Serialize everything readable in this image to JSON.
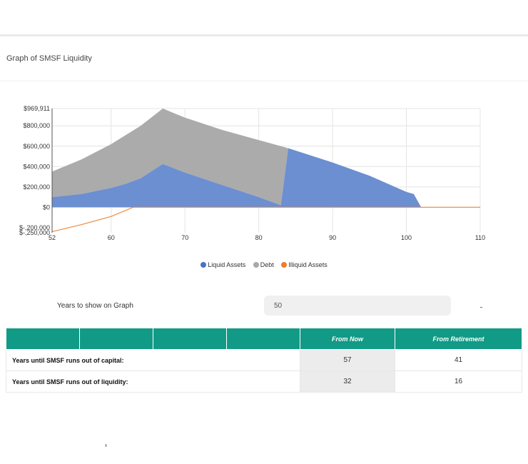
{
  "header": {
    "title": "Graph of SMSF Liquidity"
  },
  "chart_data": {
    "type": "area",
    "x_ticks": [
      "52",
      "60",
      "70",
      "80",
      "90",
      "100",
      "110"
    ],
    "xlim": [
      52,
      110
    ],
    "y_ticks": [
      {
        "value": 969911,
        "label": "$969,911"
      },
      {
        "value": 800000,
        "label": "$800,000"
      },
      {
        "value": 600000,
        "label": "$600,000"
      },
      {
        "value": 400000,
        "label": "$400,000"
      },
      {
        "value": 200000,
        "label": "$200,000"
      },
      {
        "value": 0,
        "label": "$0"
      },
      {
        "value": -200000,
        "label": "$-,200,000"
      },
      {
        "value": -250000,
        "label": "$-,250,000"
      }
    ],
    "ylim": [
      -250000,
      969911
    ],
    "grid": true,
    "legend_position": "bottom",
    "series": [
      {
        "name": "Liquid Assets",
        "color": "#6b8fd0",
        "points": [
          [
            52,
            100000
          ],
          [
            56,
            130000
          ],
          [
            60,
            190000
          ],
          [
            62,
            230000
          ],
          [
            64,
            285000
          ],
          [
            67,
            425000
          ],
          [
            70,
            340000
          ],
          [
            75,
            220000
          ],
          [
            80,
            100000
          ],
          [
            83,
            20000
          ],
          [
            84,
            580000
          ],
          [
            87,
            510000
          ],
          [
            90,
            440000
          ],
          [
            95,
            310000
          ],
          [
            100,
            150000
          ],
          [
            101,
            130000
          ],
          [
            102,
            0
          ]
        ]
      },
      {
        "name": "Debt",
        "color": "#ababab",
        "points": [
          [
            52,
            350000
          ],
          [
            56,
            470000
          ],
          [
            60,
            620000
          ],
          [
            64,
            800000
          ],
          [
            67,
            969911
          ],
          [
            70,
            880000
          ],
          [
            75,
            760000
          ],
          [
            80,
            660000
          ],
          [
            83,
            600000
          ],
          [
            84,
            580000
          ],
          [
            84,
            0
          ],
          [
            83,
            20000
          ]
        ]
      },
      {
        "name": "Illiquid Assets",
        "color": "#ef8a3c",
        "points": [
          [
            52,
            -240000
          ],
          [
            56,
            -170000
          ],
          [
            60,
            -90000
          ],
          [
            63,
            0
          ],
          [
            110,
            0
          ]
        ]
      }
    ]
  },
  "legend": {
    "items": [
      {
        "label": "Liquid Assets",
        "color": "#4a72c4"
      },
      {
        "label": "Debt",
        "color": "#a9a9a9"
      },
      {
        "label": "Illiquid Assets",
        "color": "#ef7b2d"
      }
    ]
  },
  "controls": {
    "years_label": "Years to show on Graph",
    "years_value": "50"
  },
  "table": {
    "headers": [
      "",
      "",
      "",
      "",
      "From Now",
      "From Retirement"
    ],
    "rows": [
      {
        "label": "Years until SMSF runs out of capital:",
        "from_now": "57",
        "from_retirement": "41"
      },
      {
        "label": "Years until SMSF runs out of liquidity:",
        "from_now": "32",
        "from_retirement": "16"
      }
    ]
  }
}
